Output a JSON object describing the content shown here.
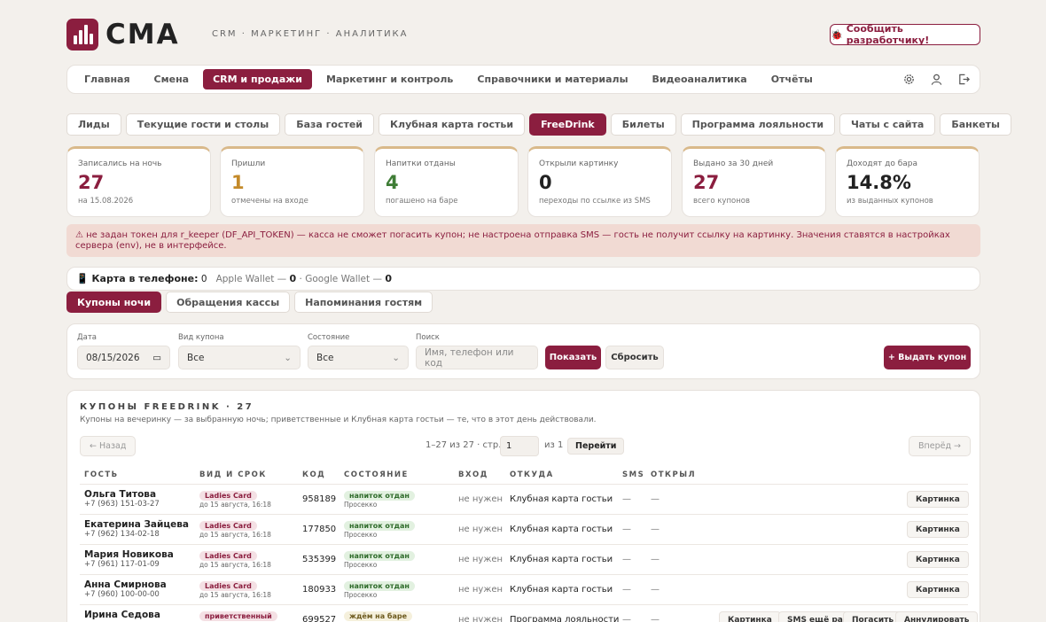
{
  "header": {
    "logo_text": "CMA",
    "top_nav": "CRM · МАРКЕТИНГ · АНАЛИТИКА",
    "report_button": "Сообщить разработчику!"
  },
  "main_nav": {
    "items": [
      "Главная",
      "Смена",
      "CRM и продажи",
      "Маркетинг и контроль",
      "Справочники и материалы",
      "Видеоаналитика",
      "Отчёты"
    ],
    "active": "CRM и продажи"
  },
  "sub_tabs": {
    "items": [
      "Лиды",
      "Текущие гости и столы",
      "База гостей",
      "Клубная карта гостьи",
      "FreeDrink",
      "Билеты",
      "Программа лояльности",
      "Чаты с сайта",
      "Банкеты"
    ],
    "active": "FreeDrink"
  },
  "stats": [
    {
      "label": "Записались на ночь",
      "value": "27",
      "sub": "на 15.08.2026",
      "color": "#8b1e3f"
    },
    {
      "label": "Пришли",
      "value": "1",
      "sub": "отмечены на входе",
      "color": "#c48a2a"
    },
    {
      "label": "Напитки отданы",
      "value": "4",
      "sub": "погашено на баре",
      "color": "#3f7d36"
    },
    {
      "label": "Открыли картинку",
      "value": "0",
      "sub": "переходы по ссылке из SMS",
      "color": "#222222"
    },
    {
      "label": "Выдано за 30 дней",
      "value": "27",
      "sub": "всего купонов",
      "color": "#8b1e3f"
    },
    {
      "label": "Доходят до бара",
      "value": "14.8%",
      "sub": "из выданных купонов",
      "color": "#222222"
    }
  ],
  "warning": "⚠ не задан токен для r_keeper (DF_API_TOKEN) — касса не сможет погасить купон; не настроена отправка SMS — гость не получит ссылку на картинку. Значения ставятся в настройках сервера (env), не в интерфейсе.",
  "phone_card": {
    "label": "📱 Карта в телефоне:",
    "count": "0",
    "apple": "Apple Wallet —",
    "apple_count": "0",
    "google": "· Google Wallet —",
    "google_count": "0"
  },
  "content_tabs": {
    "items": [
      "Купоны ночи",
      "Обращения кассы",
      "Напоминания гостям"
    ],
    "active": "Купоны ночи"
  },
  "filters": {
    "date_label": "Дата",
    "date_value": "08/15/2026",
    "type_label": "Вид купона",
    "type_value": "Все",
    "state_label": "Состояние",
    "state_value": "Все",
    "search_label": "Поиск",
    "search_placeholder": "Имя, телефон или код",
    "show_button": "Показать",
    "reset_button": "Сбросить",
    "issue_button": "+ Выдать купон"
  },
  "panel": {
    "title": "КУПОНЫ FREEDRINK · 27",
    "subtitle": "Купоны на вечеринку — за выбранную ночь; приветственные и Клубная карта гостьи — те, что в этот день действовали.",
    "prev": "← Назад",
    "next": "Вперёд →",
    "range": "1–27 из 27 · стр.",
    "page_value": "1",
    "of_pages": "из 1",
    "go": "Перейти",
    "columns": [
      "ГОСТЬ",
      "ВИД И СРОК",
      "КОД",
      "СОСТОЯНИЕ",
      "ВХОД",
      "ОТКУДА",
      "SMS",
      "ОТКРЫЛ"
    ]
  },
  "rows": [
    {
      "name": "Ольга Титова",
      "phone": "+7 (963) 151-03-27",
      "type": "Ladies Card",
      "until": "до 15 августа, 16:18",
      "code": "958189",
      "state": "напиток отдан",
      "state2": "Просеккo",
      "entry": "не нужен",
      "source": "Клубная карта гостьи",
      "sms": "—",
      "opened": "—",
      "actions": [
        "Картинка"
      ]
    },
    {
      "name": "Екатерина Зайцева",
      "phone": "+7 (962) 134-02-18",
      "type": "Ladies Card",
      "until": "до 15 августа, 16:18",
      "code": "177850",
      "state": "напиток отдан",
      "state2": "Просекко",
      "entry": "не нужен",
      "source": "Клубная карта гостьи",
      "sms": "—",
      "opened": "—",
      "actions": [
        "Картинка"
      ]
    },
    {
      "name": "Мария Новикова",
      "phone": "+7 (961) 117-01-09",
      "type": "Ladies Card",
      "until": "до 15 августа, 16:18",
      "code": "535399",
      "state": "напиток отдан",
      "state2": "Просекко",
      "entry": "не нужен",
      "source": "Клубная карта гостьи",
      "sms": "—",
      "opened": "—",
      "actions": [
        "Картинка"
      ]
    },
    {
      "name": "Анна Смирнова",
      "phone": "+7 (960) 100-00-00",
      "type": "Ladies Card",
      "until": "до 15 августа, 16:18",
      "code": "180933",
      "state": "напиток отдан",
      "state2": "Просекко",
      "entry": "не нужен",
      "source": "Клубная карта гостьи",
      "sms": "—",
      "opened": "—",
      "actions": [
        "Картинка"
      ]
    },
    {
      "name": "Ирина Седова",
      "phone": "",
      "type": "приветственный",
      "until": "",
      "code": "699527",
      "state": "ждём на баре",
      "state2": "",
      "entry": "не нужен",
      "source": "Программа лояльности",
      "sms": "—",
      "opened": "—",
      "actions": [
        "Картинка",
        "SMS ещё раз",
        "Погасить",
        "Аннулировать"
      ]
    }
  ]
}
